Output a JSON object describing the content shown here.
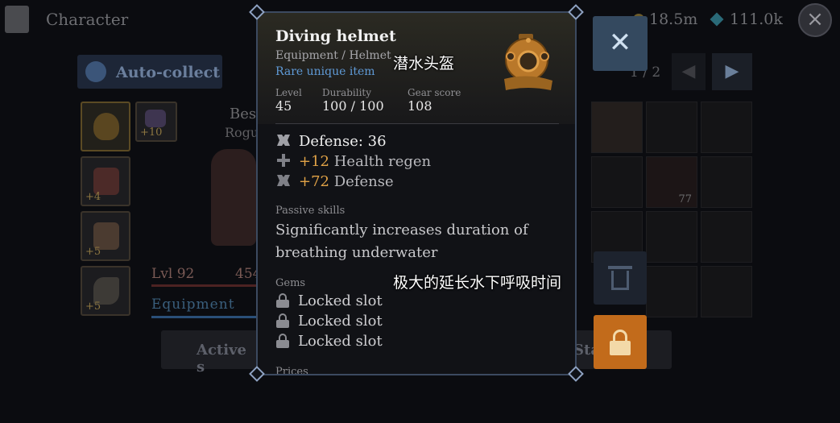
{
  "topbar": {
    "title": "Character",
    "gold": "18.5m",
    "gems": "111.0k",
    "icons": [
      "character-icon",
      "coin-icon",
      "diamond-icon",
      "close-icon"
    ]
  },
  "left": {
    "autocollect_label": "Auto-collect",
    "slots": [
      {
        "plus": ""
      },
      {
        "plus": "+10"
      },
      {
        "plus": "+4"
      },
      {
        "plus": "+5"
      },
      {
        "plus": "+5"
      }
    ],
    "char_name": "Bes",
    "char_class": "Rogu",
    "level_label": "Lvl 92",
    "level_value": "454",
    "equipment_tab": "Equipment",
    "active_button": "Active s"
  },
  "right": {
    "page": "1 / 2",
    "stats_button": "Sta",
    "inventory_count": "77"
  },
  "tooltip": {
    "name": "Diving helmet",
    "type": "Equipment / Helmet",
    "rarity": "Rare unique item",
    "level_label": "Level",
    "level": "45",
    "durability_label": "Durability",
    "durability": "100 / 100",
    "gearscore_label": "Gear score",
    "gearscore": "108",
    "base_stat": "Defense: 36",
    "bonuses": [
      {
        "value": "+12",
        "label": "Health regen"
      },
      {
        "value": "+72",
        "label": "Defense"
      }
    ],
    "passive_title": "Passive skills",
    "passive_text": "Significantly increases duration of breathing underwater",
    "gems_title": "Gems",
    "gem_slots": [
      "Locked slot",
      "Locked slot",
      "Locked slot"
    ],
    "prices_title": "Prices"
  },
  "subtitles": {
    "name_cn": "潜水头盔",
    "passive_cn": "极大的延长水下呼吸时间"
  },
  "colors": {
    "bonus": "#e0a247",
    "rarity": "#5f9ad6",
    "lock_button": "#c26b1b",
    "close_button": "#34495f"
  }
}
